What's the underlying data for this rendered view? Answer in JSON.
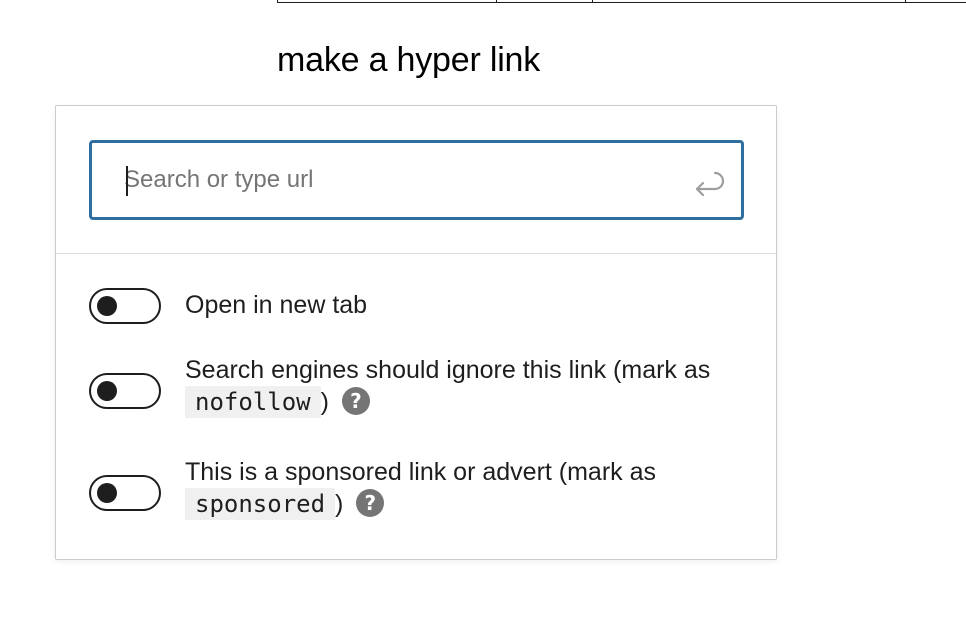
{
  "heading": "make a hyper link",
  "link_control": {
    "search": {
      "placeholder": "Search or type url",
      "value": "",
      "submit_icon": "enter-return-icon"
    },
    "settings": [
      {
        "label_before": "Open in new tab",
        "code": "",
        "label_after": "",
        "enabled": false,
        "has_help": false
      },
      {
        "label_before": "Search engines should ignore this link (mark as",
        "code": "nofollow",
        "label_after": ")",
        "enabled": false,
        "has_help": true,
        "help_icon": "question-circle-icon",
        "help_glyph": "?"
      },
      {
        "label_before": "This is a sponsored link or advert (mark as",
        "code": "sponsored",
        "label_after": ")",
        "enabled": false,
        "has_help": true,
        "help_icon": "question-circle-icon",
        "help_glyph": "?"
      }
    ]
  },
  "colors": {
    "focus_border": "#2f6f9f",
    "toggle": "#1e1e1e",
    "help_icon": "#757575",
    "code_background": "#f0f0f0"
  }
}
